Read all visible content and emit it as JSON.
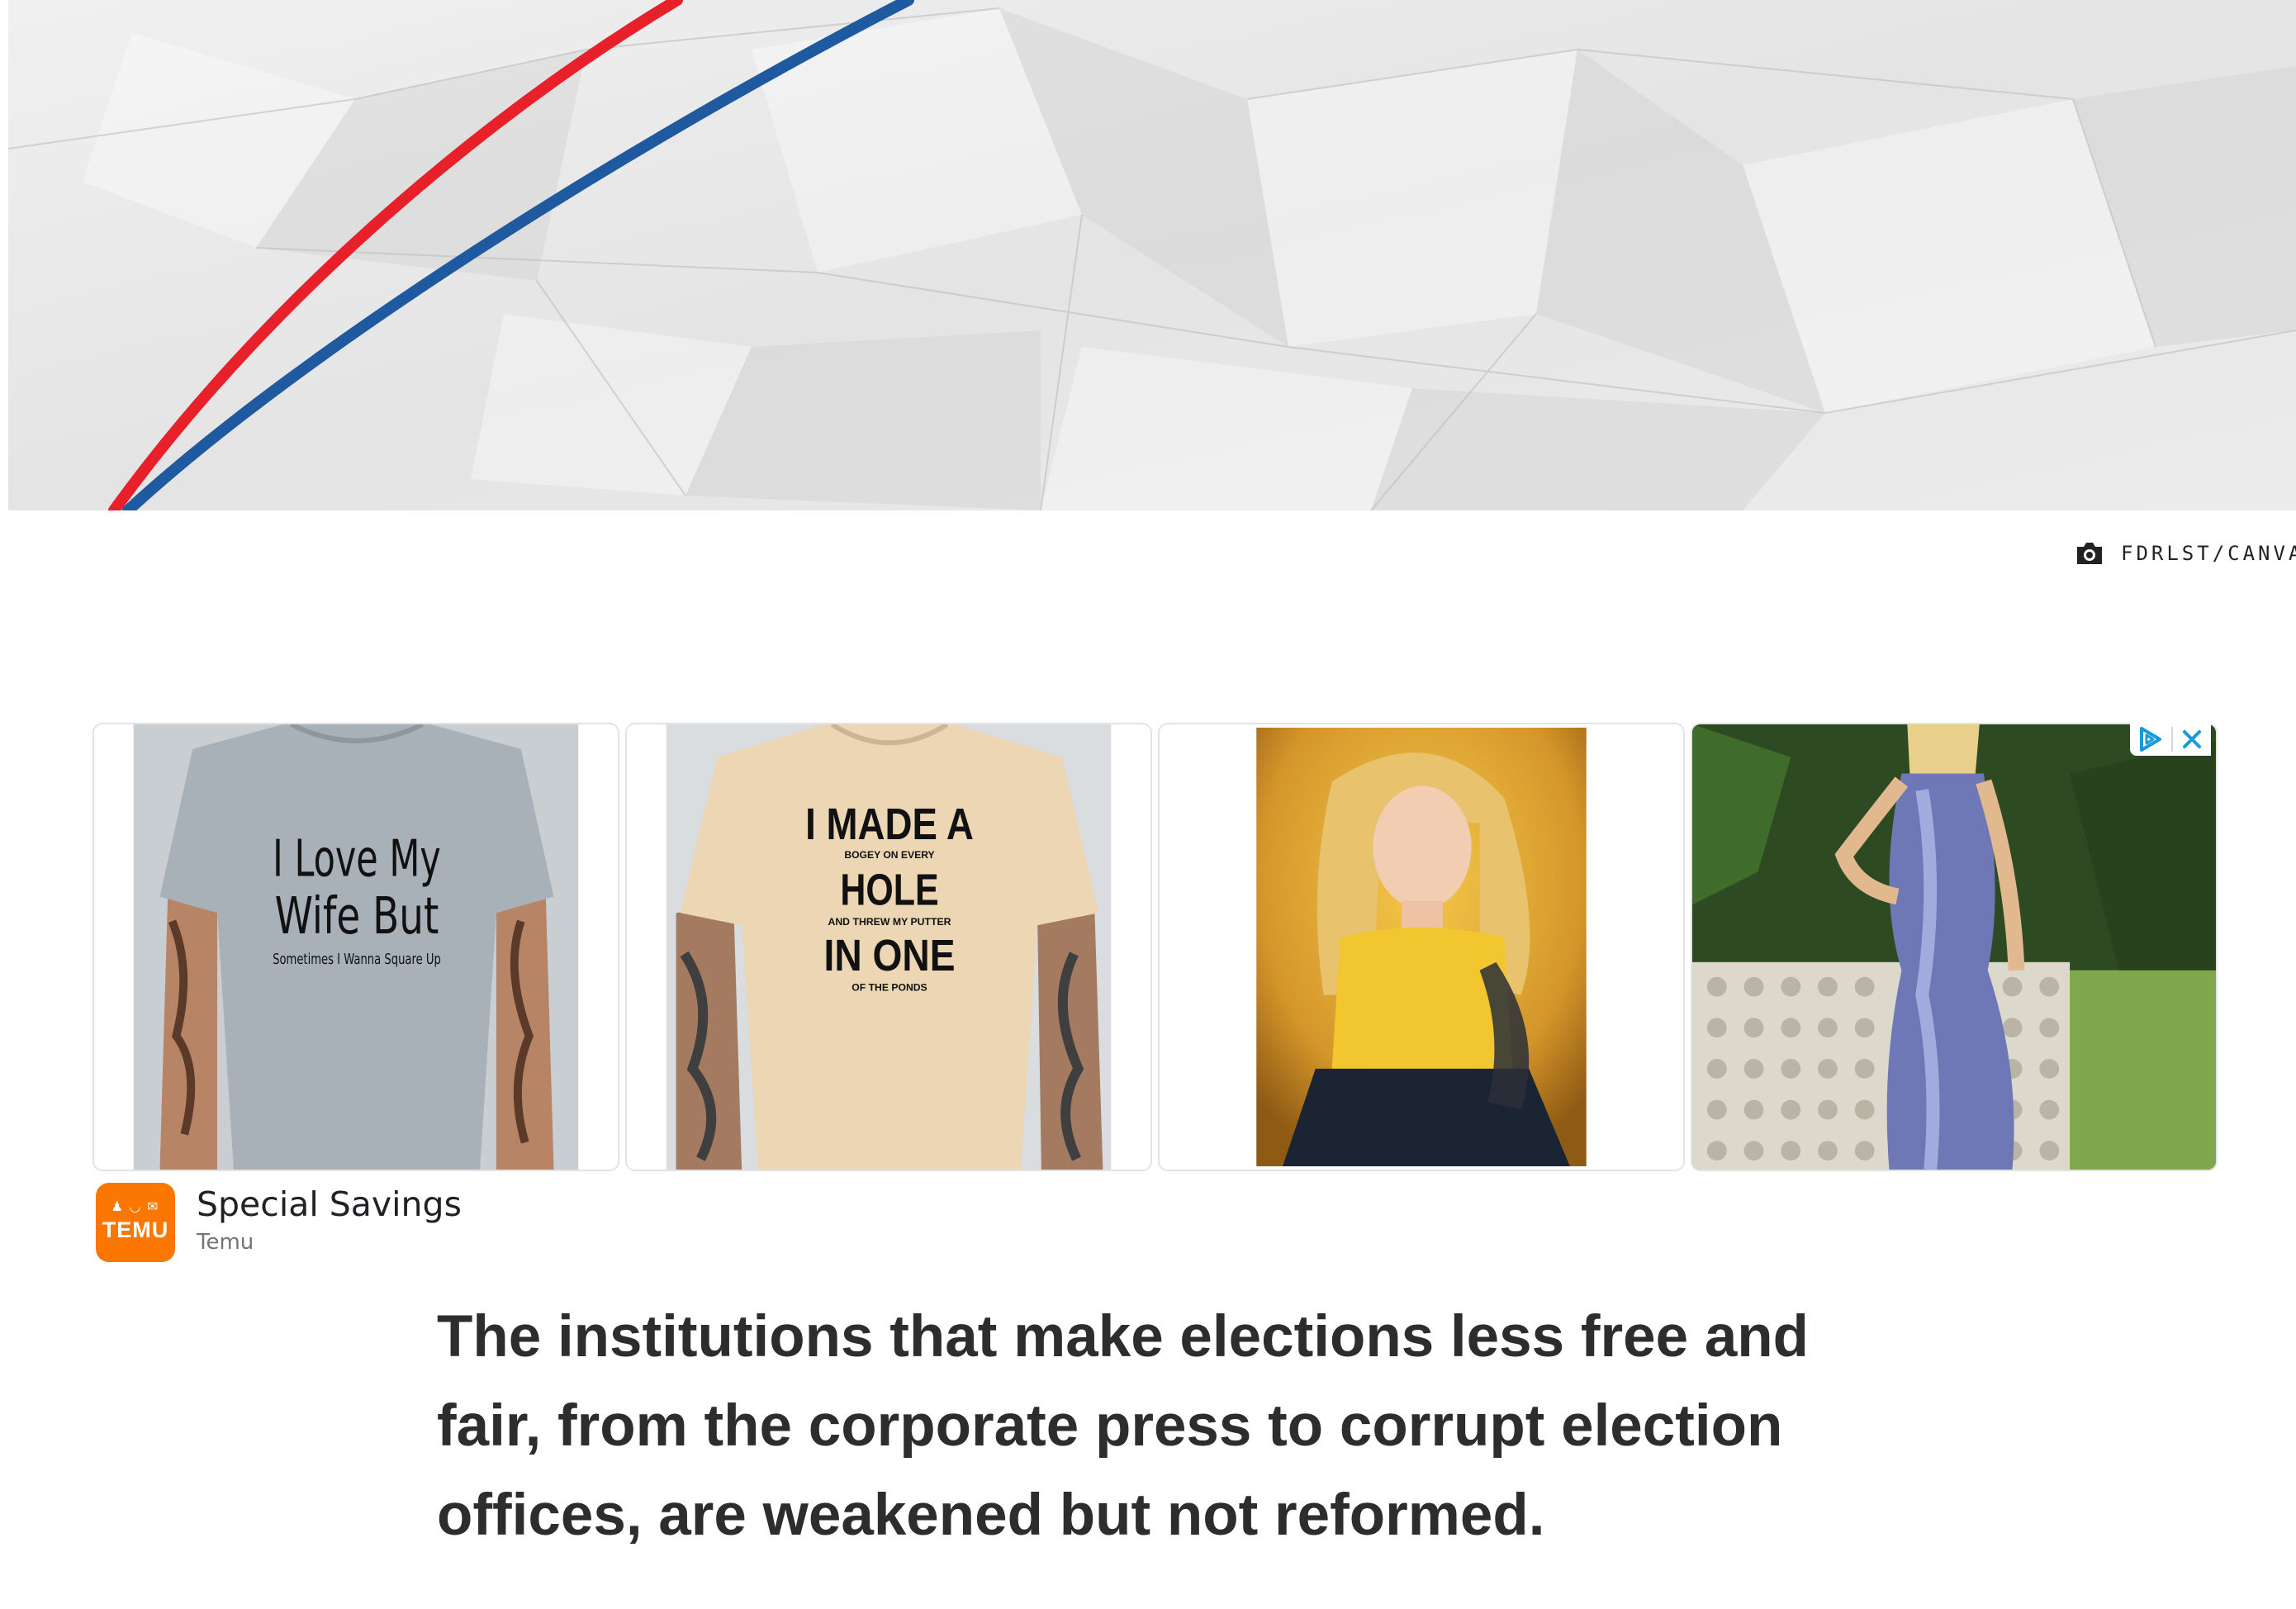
{
  "photo_credit": {
    "icon": "camera-icon",
    "text": "FDRLST/CANVA"
  },
  "ad": {
    "controls": {
      "adchoices_icon": "adchoices-icon",
      "close_icon": "close-icon"
    },
    "tiles": [
      {
        "shirt_color": "#a9b1b8",
        "shirt_text": [
          "I Love My",
          "Wife But",
          "Sometimes I Wanna Square Up"
        ]
      },
      {
        "shirt_color": "#ecd6b4",
        "shirt_text": [
          "I MADE A",
          "BOGEY ON EVERY",
          "HOLE",
          "AND THREW MY PUTTER",
          "IN ONE",
          "OF THE PONDS"
        ]
      },
      {
        "description_icon": "woman-yellow-dress-painting"
      },
      {
        "description_icon": "woman-metallic-dress-photo"
      }
    ],
    "brand": {
      "logo_text": "TEMU",
      "headline": "Special Savings",
      "advertiser": "Temu",
      "brand_color": "#fb7701"
    }
  },
  "article": {
    "paragraph": "The institutions that make elections less free and fair, from the corporate press to corrupt election offices, are weakened but not reformed."
  },
  "colors": {
    "stripe_red": "#e8202a",
    "stripe_blue": "#1f5aa0",
    "text_dark": "#2d2d2d"
  }
}
